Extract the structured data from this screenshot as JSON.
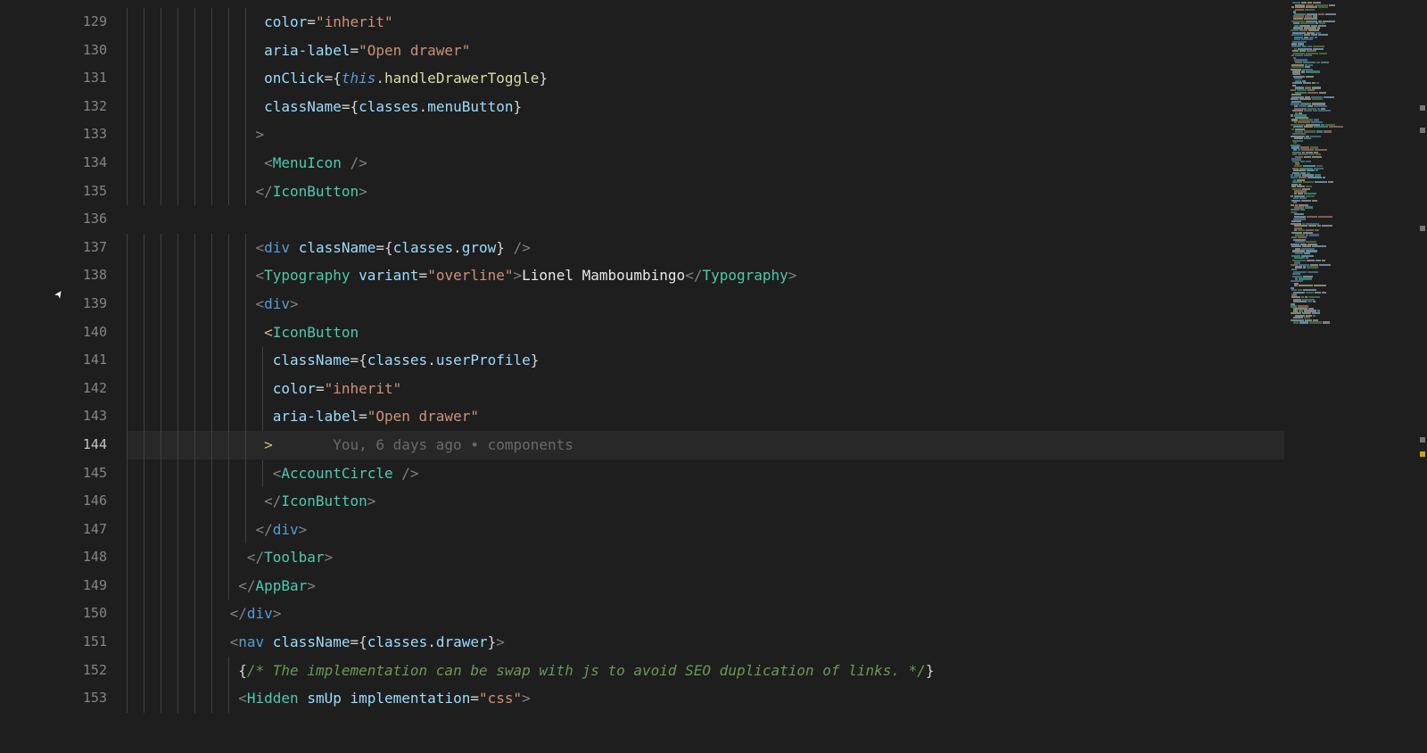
{
  "editor": {
    "first_line": 129,
    "active_line": 144,
    "code_lens": "You, 6 days ago • components",
    "cursor_position": {
      "line": 144,
      "column_char": ">"
    },
    "lines": {
      "l129": {
        "indent": 16,
        "tokens": [
          {
            "cls": "c-attr",
            "t": "color"
          },
          {
            "cls": "c-punc",
            "t": "="
          },
          {
            "cls": "c-str",
            "t": "\"inherit\""
          }
        ]
      },
      "l130": {
        "indent": 16,
        "tokens": [
          {
            "cls": "c-attr",
            "t": "aria-label"
          },
          {
            "cls": "c-punc",
            "t": "="
          },
          {
            "cls": "c-str",
            "t": "\"Open drawer\""
          }
        ]
      },
      "l131": {
        "indent": 16,
        "tokens": [
          {
            "cls": "c-attr",
            "t": "onClick"
          },
          {
            "cls": "c-punc",
            "t": "="
          },
          {
            "cls": "c-brace",
            "t": "{"
          },
          {
            "cls": "c-this",
            "t": "this"
          },
          {
            "cls": "c-punc",
            "t": "."
          },
          {
            "cls": "c-prop",
            "t": "handleDrawerToggle"
          },
          {
            "cls": "c-brace",
            "t": "}"
          }
        ]
      },
      "l132": {
        "indent": 16,
        "tokens": [
          {
            "cls": "c-attr",
            "t": "className"
          },
          {
            "cls": "c-punc",
            "t": "="
          },
          {
            "cls": "c-brace",
            "t": "{"
          },
          {
            "cls": "c-var",
            "t": "classes"
          },
          {
            "cls": "c-punc",
            "t": "."
          },
          {
            "cls": "c-var",
            "t": "menuButton"
          },
          {
            "cls": "c-brace",
            "t": "}"
          }
        ]
      },
      "l133": {
        "indent": 15,
        "tokens": [
          {
            "cls": "c-ang",
            "t": ">"
          }
        ]
      },
      "l134": {
        "indent": 16,
        "tokens": [
          {
            "cls": "c-ang",
            "t": "<"
          },
          {
            "cls": "c-tag",
            "t": "MenuIcon"
          },
          {
            "cls": "c-int",
            "t": " "
          },
          {
            "cls": "c-ang",
            "t": "/>"
          }
        ]
      },
      "l135": {
        "indent": 15,
        "tokens": [
          {
            "cls": "c-ang",
            "t": "</"
          },
          {
            "cls": "c-tag",
            "t": "IconButton"
          },
          {
            "cls": "c-ang",
            "t": ">"
          }
        ]
      },
      "l136": {
        "indent": 0,
        "tokens": []
      },
      "l137": {
        "indent": 15,
        "tokens": [
          {
            "cls": "c-ang",
            "t": "<"
          },
          {
            "cls": "c-kw",
            "t": "div"
          },
          {
            "cls": "c-int",
            "t": " "
          },
          {
            "cls": "c-attr",
            "t": "className"
          },
          {
            "cls": "c-punc",
            "t": "="
          },
          {
            "cls": "c-brace",
            "t": "{"
          },
          {
            "cls": "c-var",
            "t": "classes"
          },
          {
            "cls": "c-punc",
            "t": "."
          },
          {
            "cls": "c-var",
            "t": "grow"
          },
          {
            "cls": "c-brace",
            "t": "}"
          },
          {
            "cls": "c-int",
            "t": " "
          },
          {
            "cls": "c-ang",
            "t": "/>"
          }
        ]
      },
      "l138": {
        "indent": 15,
        "tokens": [
          {
            "cls": "c-ang",
            "t": "<"
          },
          {
            "cls": "c-tag",
            "t": "Typography"
          },
          {
            "cls": "c-int",
            "t": " "
          },
          {
            "cls": "c-attr",
            "t": "variant"
          },
          {
            "cls": "c-punc",
            "t": "="
          },
          {
            "cls": "c-str",
            "t": "\"overline\""
          },
          {
            "cls": "c-ang",
            "t": ">"
          },
          {
            "cls": "c-int",
            "t": "Lionel Mamboumbingo"
          },
          {
            "cls": "c-ang",
            "t": "</"
          },
          {
            "cls": "c-tag",
            "t": "Typography"
          },
          {
            "cls": "c-ang",
            "t": ">"
          }
        ]
      },
      "l139": {
        "indent": 15,
        "tokens": [
          {
            "cls": "c-ang",
            "t": "<"
          },
          {
            "cls": "c-kw",
            "t": "div"
          },
          {
            "cls": "c-ang",
            "t": ">"
          }
        ]
      },
      "l140": {
        "indent": 16,
        "tokens": [
          {
            "cls": "c-bracket-match",
            "t": "<"
          },
          {
            "cls": "c-tag",
            "t": "IconButton"
          }
        ]
      },
      "l141": {
        "indent": 17,
        "tokens": [
          {
            "cls": "c-attr",
            "t": "className"
          },
          {
            "cls": "c-punc",
            "t": "="
          },
          {
            "cls": "c-brace",
            "t": "{"
          },
          {
            "cls": "c-var",
            "t": "classes"
          },
          {
            "cls": "c-punc",
            "t": "."
          },
          {
            "cls": "c-var",
            "t": "userProfile"
          },
          {
            "cls": "c-brace",
            "t": "}"
          }
        ]
      },
      "l142": {
        "indent": 17,
        "tokens": [
          {
            "cls": "c-attr",
            "t": "color"
          },
          {
            "cls": "c-punc",
            "t": "="
          },
          {
            "cls": "c-str",
            "t": "\"inherit\""
          }
        ]
      },
      "l143": {
        "indent": 17,
        "tokens": [
          {
            "cls": "c-attr",
            "t": "aria-label"
          },
          {
            "cls": "c-punc",
            "t": "="
          },
          {
            "cls": "c-str",
            "t": "\"Open drawer\""
          }
        ]
      },
      "l144": {
        "indent": 16,
        "tokens": [
          {
            "cls": "c-bracket-match",
            "t": ">"
          },
          {
            "cls": "c-lens",
            "t": "       You, 6 days ago • components"
          }
        ]
      },
      "l145": {
        "indent": 17,
        "tokens": [
          {
            "cls": "c-ang",
            "t": "<"
          },
          {
            "cls": "c-tag",
            "t": "AccountCircle"
          },
          {
            "cls": "c-int",
            "t": " "
          },
          {
            "cls": "c-ang",
            "t": "/>"
          }
        ]
      },
      "l146": {
        "indent": 16,
        "tokens": [
          {
            "cls": "c-ang",
            "t": "</"
          },
          {
            "cls": "c-tag",
            "t": "IconButton"
          },
          {
            "cls": "c-ang",
            "t": ">"
          }
        ]
      },
      "l147": {
        "indent": 15,
        "tokens": [
          {
            "cls": "c-ang",
            "t": "</"
          },
          {
            "cls": "c-kw",
            "t": "div"
          },
          {
            "cls": "c-ang",
            "t": ">"
          }
        ]
      },
      "l148": {
        "indent": 14,
        "tokens": [
          {
            "cls": "c-ang",
            "t": "</"
          },
          {
            "cls": "c-tag",
            "t": "Toolbar"
          },
          {
            "cls": "c-ang",
            "t": ">"
          }
        ]
      },
      "l149": {
        "indent": 13,
        "tokens": [
          {
            "cls": "c-ang",
            "t": "</"
          },
          {
            "cls": "c-tag",
            "t": "AppBar"
          },
          {
            "cls": "c-ang",
            "t": ">"
          }
        ]
      },
      "l150": {
        "indent": 12,
        "tokens": [
          {
            "cls": "c-ang",
            "t": "</"
          },
          {
            "cls": "c-kw",
            "t": "div"
          },
          {
            "cls": "c-ang",
            "t": ">"
          }
        ]
      },
      "l151": {
        "indent": 12,
        "tokens": [
          {
            "cls": "c-ang",
            "t": "<"
          },
          {
            "cls": "c-kw",
            "t": "nav"
          },
          {
            "cls": "c-int",
            "t": " "
          },
          {
            "cls": "c-attr",
            "t": "className"
          },
          {
            "cls": "c-punc",
            "t": "="
          },
          {
            "cls": "c-brace",
            "t": "{"
          },
          {
            "cls": "c-var",
            "t": "classes"
          },
          {
            "cls": "c-punc",
            "t": "."
          },
          {
            "cls": "c-var",
            "t": "drawer"
          },
          {
            "cls": "c-brace",
            "t": "}"
          },
          {
            "cls": "c-ang",
            "t": ">"
          }
        ]
      },
      "l152": {
        "indent": 13,
        "tokens": [
          {
            "cls": "c-brace",
            "t": "{"
          },
          {
            "cls": "c-comment",
            "t": "/* The implementation can be swap with js to avoid SEO duplication of links. */"
          },
          {
            "cls": "c-brace",
            "t": "}"
          }
        ]
      },
      "l153": {
        "indent": 13,
        "tokens": [
          {
            "cls": "c-ang",
            "t": "<"
          },
          {
            "cls": "c-tag",
            "t": "Hidden"
          },
          {
            "cls": "c-int",
            "t": " "
          },
          {
            "cls": "c-attr",
            "t": "smUp"
          },
          {
            "cls": "c-int",
            "t": " "
          },
          {
            "cls": "c-attr",
            "t": "implementation"
          },
          {
            "cls": "c-punc",
            "t": "="
          },
          {
            "cls": "c-str",
            "t": "\"css\""
          },
          {
            "cls": "c-ang",
            "t": ">"
          }
        ]
      }
    }
  },
  "minimap": {
    "overview_marks": [
      {
        "top_pct": 14,
        "type": "normal"
      },
      {
        "top_pct": 17,
        "type": "normal"
      },
      {
        "top_pct": 30,
        "type": "normal"
      },
      {
        "top_pct": 58,
        "type": "normal"
      },
      {
        "top_pct": 60,
        "type": "warn"
      }
    ]
  }
}
